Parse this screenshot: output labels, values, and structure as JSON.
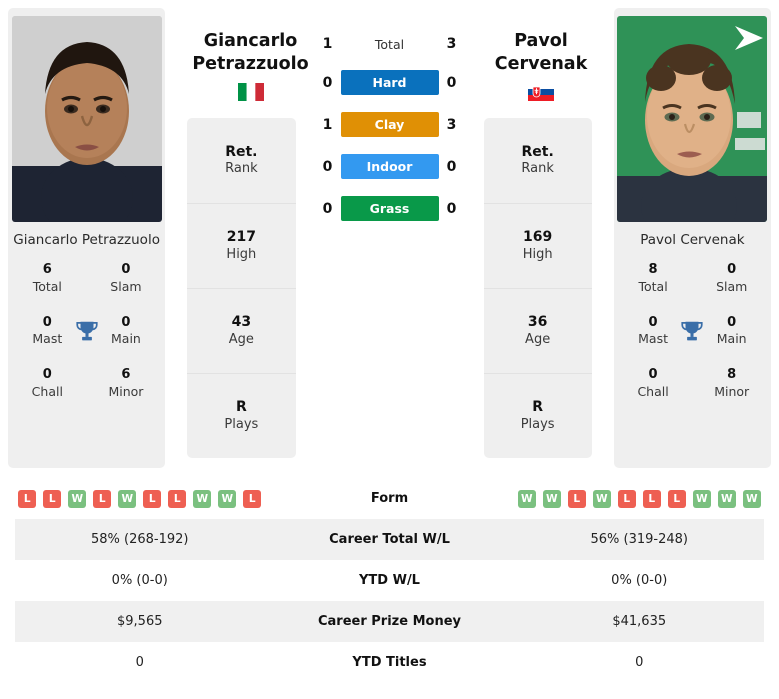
{
  "players": {
    "left": {
      "first_name": "Giancarlo",
      "last_name": "Petrazzuolo",
      "full_name": "Giancarlo Petrazzuolo",
      "country": "Italy",
      "flag_icon": "flag-italy-icon",
      "card": [
        {
          "value": "Ret.",
          "label": "Rank"
        },
        {
          "value": "217",
          "label": "High"
        },
        {
          "value": "43",
          "label": "Age"
        },
        {
          "value": "R",
          "label": "Plays"
        }
      ],
      "titles": [
        {
          "num": "6",
          "label": "Total"
        },
        {
          "num": "0",
          "label": "Slam"
        },
        {
          "num": "0",
          "label": "Mast"
        },
        {
          "num": "0",
          "label": "Main"
        },
        {
          "num": "0",
          "label": "Chall"
        },
        {
          "num": "6",
          "label": "Minor"
        }
      ],
      "form": [
        "L",
        "L",
        "W",
        "L",
        "W",
        "L",
        "L",
        "W",
        "W",
        "L"
      ],
      "career_total_wl": "58% (268-192)",
      "ytd_wl": "0% (0-0)",
      "career_prize_money": "$9,565",
      "ytd_titles": "0"
    },
    "right": {
      "first_name": "Pavol",
      "last_name": "Cervenak",
      "full_name": "Pavol Cervenak",
      "country": "Slovakia",
      "flag_icon": "flag-slovakia-icon",
      "card": [
        {
          "value": "Ret.",
          "label": "Rank"
        },
        {
          "value": "169",
          "label": "High"
        },
        {
          "value": "36",
          "label": "Age"
        },
        {
          "value": "R",
          "label": "Plays"
        }
      ],
      "titles": [
        {
          "num": "8",
          "label": "Total"
        },
        {
          "num": "0",
          "label": "Slam"
        },
        {
          "num": "0",
          "label": "Mast"
        },
        {
          "num": "0",
          "label": "Main"
        },
        {
          "num": "0",
          "label": "Chall"
        },
        {
          "num": "8",
          "label": "Minor"
        }
      ],
      "form": [
        "W",
        "W",
        "L",
        "W",
        "L",
        "L",
        "L",
        "W",
        "W",
        "W"
      ],
      "career_total_wl": "56% (319-248)",
      "ytd_wl": "0% (0-0)",
      "career_prize_money": "$41,635",
      "ytd_titles": "0"
    }
  },
  "h2h": [
    {
      "label": "Total",
      "left": "1",
      "right": "3",
      "color": "",
      "is_bar": false
    },
    {
      "label": "Hard",
      "left": "0",
      "right": "0",
      "color": "#0a71bd",
      "is_bar": true
    },
    {
      "label": "Clay",
      "left": "1",
      "right": "3",
      "color": "#e09005",
      "is_bar": true
    },
    {
      "label": "Indoor",
      "left": "0",
      "right": "0",
      "color": "#3399f0",
      "is_bar": true
    },
    {
      "label": "Grass",
      "left": "0",
      "right": "0",
      "color": "#099949",
      "is_bar": true
    }
  ],
  "table_rows": [
    {
      "label": "Form",
      "type": "form",
      "left": "",
      "right": ""
    },
    {
      "label": "Career Total W/L",
      "type": "text",
      "left": "58% (268-192)",
      "right": "56% (319-248)"
    },
    {
      "label": "YTD W/L",
      "type": "text",
      "left": "0% (0-0)",
      "right": "0% (0-0)"
    },
    {
      "label": "Career Prize Money",
      "type": "text",
      "left": "$9,565",
      "right": "$41,635"
    },
    {
      "label": "YTD Titles",
      "type": "text",
      "left": "0",
      "right": "0"
    }
  ],
  "colors": {
    "hard": "#0a71bd",
    "clay": "#e09005",
    "indoor": "#3399f0",
    "grass": "#099949",
    "win": "#7ac07f",
    "loss": "#ee5f52",
    "trophy": "#3a6ea8",
    "card_bg": "#efefef"
  },
  "trophy_icon": "trophy-icon"
}
